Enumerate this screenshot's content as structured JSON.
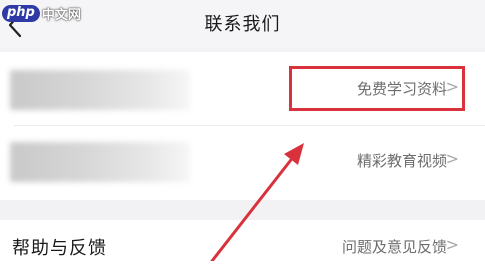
{
  "logo": {
    "brand_short": "php",
    "brand_name": "中文网"
  },
  "header": {
    "title": "联系我们",
    "back_icon": "chevron-left-icon"
  },
  "rows": [
    {
      "label": "免费学习资料",
      "highlighted": true
    },
    {
      "label": "精彩教育视频",
      "highlighted": false
    }
  ],
  "feedback": {
    "left_label": "帮助与反馈",
    "right_label": "问题及意见反馈"
  },
  "chevron_glyph": ">",
  "annotation": {
    "type": "arrow",
    "color": "#d9323c",
    "box_color": "#d9323c"
  }
}
